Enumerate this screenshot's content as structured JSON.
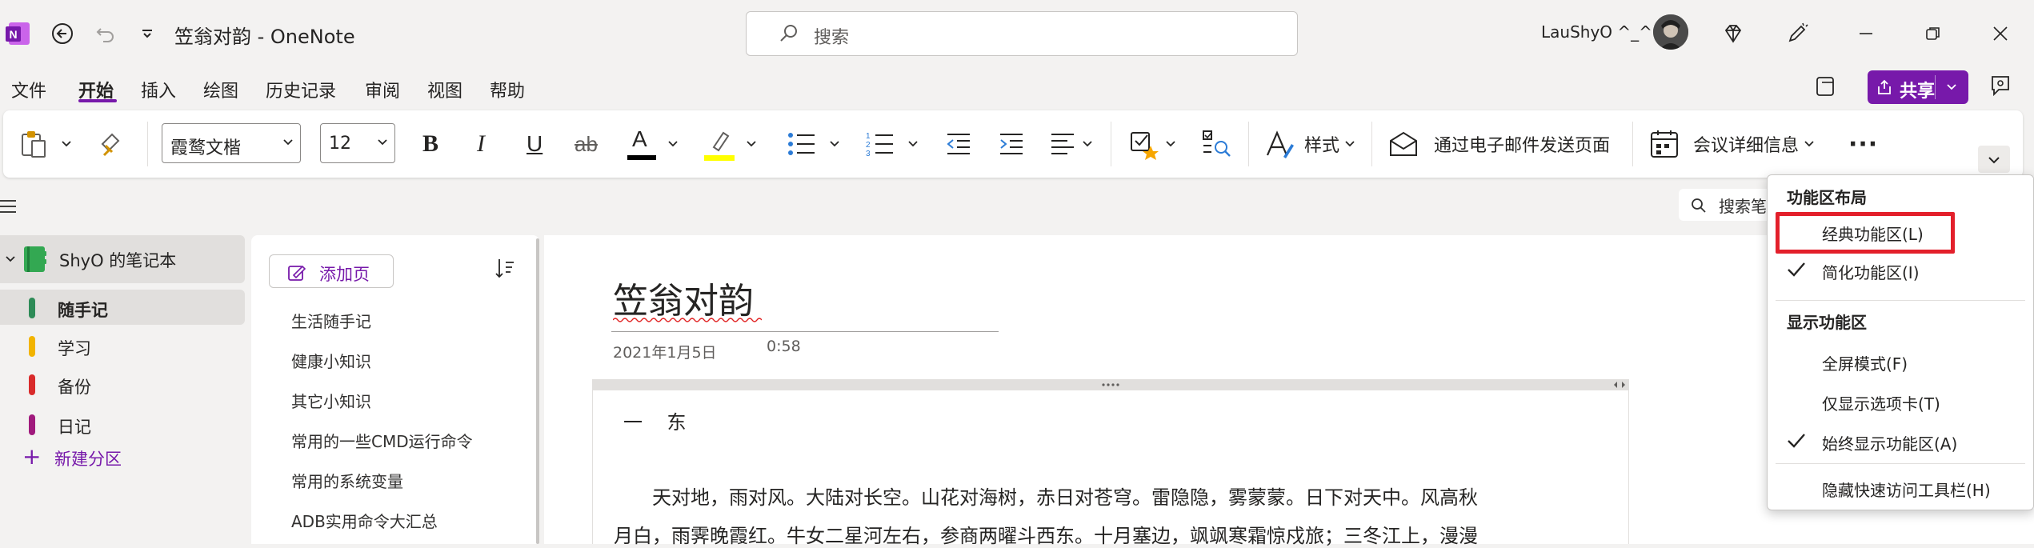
{
  "app": {
    "title": "笠翁对韵  -  OneNote",
    "search_placeholder": "搜索",
    "user_name": "LauShyO ^_^",
    "icons": [
      "onenote-logo-icon",
      "back-icon",
      "undo-icon",
      "customize-qat-icon",
      "diamond-icon",
      "pen-icon",
      "minimize-icon",
      "restore-icon",
      "close-icon"
    ]
  },
  "menu": {
    "tabs": [
      "文件",
      "开始",
      "插入",
      "绘图",
      "历史记录",
      "审阅",
      "视图",
      "帮助"
    ],
    "active_tab": "开始",
    "share_label": "共享",
    "accent_color": "#7719aa"
  },
  "ribbon": {
    "font_name": "霞鹜文楷",
    "font_size": "12",
    "bold": "B",
    "italic": "I",
    "underline": "U",
    "strike": "ab",
    "font_color_letter": "A",
    "styles_label": "样式",
    "email_page_label": "通过电子邮件发送页面",
    "meeting_details_label": "会议详细信息",
    "more": "···"
  },
  "notebook": {
    "name": "ShyO 的笔记本",
    "sections": [
      {
        "label": "随手记",
        "color": "#2e8b57",
        "selected": true
      },
      {
        "label": "学习",
        "color": "#f2b400",
        "selected": false
      },
      {
        "label": "备份",
        "color": "#d92b2b",
        "selected": false
      },
      {
        "label": "日记",
        "color": "#a01a7d",
        "selected": false
      }
    ],
    "new_section_label": "新建分区"
  },
  "pages": {
    "add_page_label": "添加页",
    "items": [
      "生活随手记",
      "健康小知识",
      "其它小知识",
      "常用的一些CMD运行命令",
      "常用的系统变量",
      "ADB实用命令大汇总"
    ]
  },
  "canvas": {
    "search_label": "搜索笔",
    "page_title": "笠翁对韵",
    "date": "2021年1月5日",
    "time": "0:58",
    "heading": "一    东",
    "paragraph_line1": "天对地，雨对风。大陆对长空。山花对海树，赤日对苍穹。雷隐隐，雾蒙蒙。日下对天中。风高秋",
    "paragraph_line2": "月白，雨霁晚霞红。牛女二星河左右，参商两曜斗西东。十月塞边，飒飒寒霜惊戍旅；三冬江上，漫漫"
  },
  "layout_menu": {
    "header1": "功能区布局",
    "classic": "经典功能区(L)",
    "simplified": "简化功能区(I)",
    "header2": "显示功能区",
    "fullscreen": "全屏模式(F)",
    "tabs_only": "仅显示选项卡(T)",
    "always_show": "始终显示功能区(A)",
    "hide_qat": "隐藏快速访问工具栏(H)",
    "checked": [
      "简化功能区(I)",
      "始终显示功能区(A)"
    ],
    "highlight_color": "#e3202b"
  }
}
